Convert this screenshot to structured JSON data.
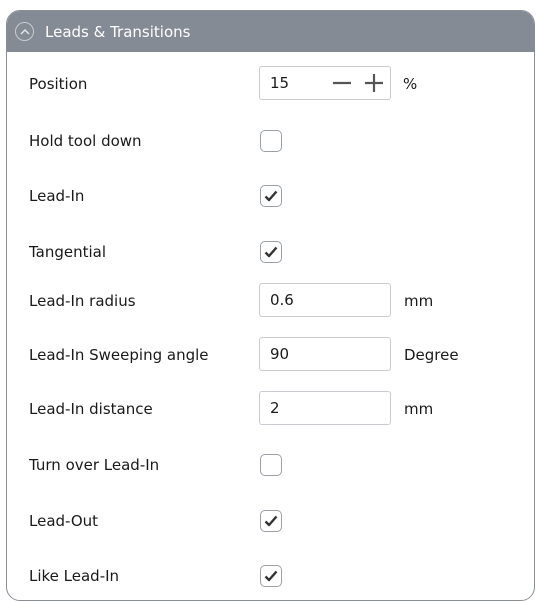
{
  "panel": {
    "title": "Leads & Transitions"
  },
  "rows": {
    "position": {
      "label": "Position",
      "value": "15",
      "unit": "%"
    },
    "hold_tool_down": {
      "label": "Hold tool down",
      "checked": false
    },
    "lead_in": {
      "label": "Lead-In",
      "checked": true
    },
    "tangential": {
      "label": "Tangential",
      "checked": true
    },
    "lead_in_radius": {
      "label": "Lead-In radius",
      "value": "0.6",
      "unit": "mm"
    },
    "lead_in_sweeping_angle": {
      "label": "Lead-In Sweeping angle",
      "value": "90",
      "unit": "Degree"
    },
    "lead_in_distance": {
      "label": "Lead-In distance",
      "value": "2",
      "unit": "mm"
    },
    "turn_over_lead_in": {
      "label": "Turn over Lead-In",
      "checked": false
    },
    "lead_out": {
      "label": "Lead-Out",
      "checked": true
    },
    "like_lead_in": {
      "label": "Like Lead-In",
      "checked": true
    }
  },
  "icons": {
    "collapse": "chevron-up-icon",
    "decrement": "minus-icon",
    "increment": "plus-icon",
    "check": "checkmark-icon"
  },
  "colors": {
    "header_bg": "#858b94",
    "header_text": "#ffffff",
    "border": "#9aa0a6",
    "check": "#333333"
  }
}
